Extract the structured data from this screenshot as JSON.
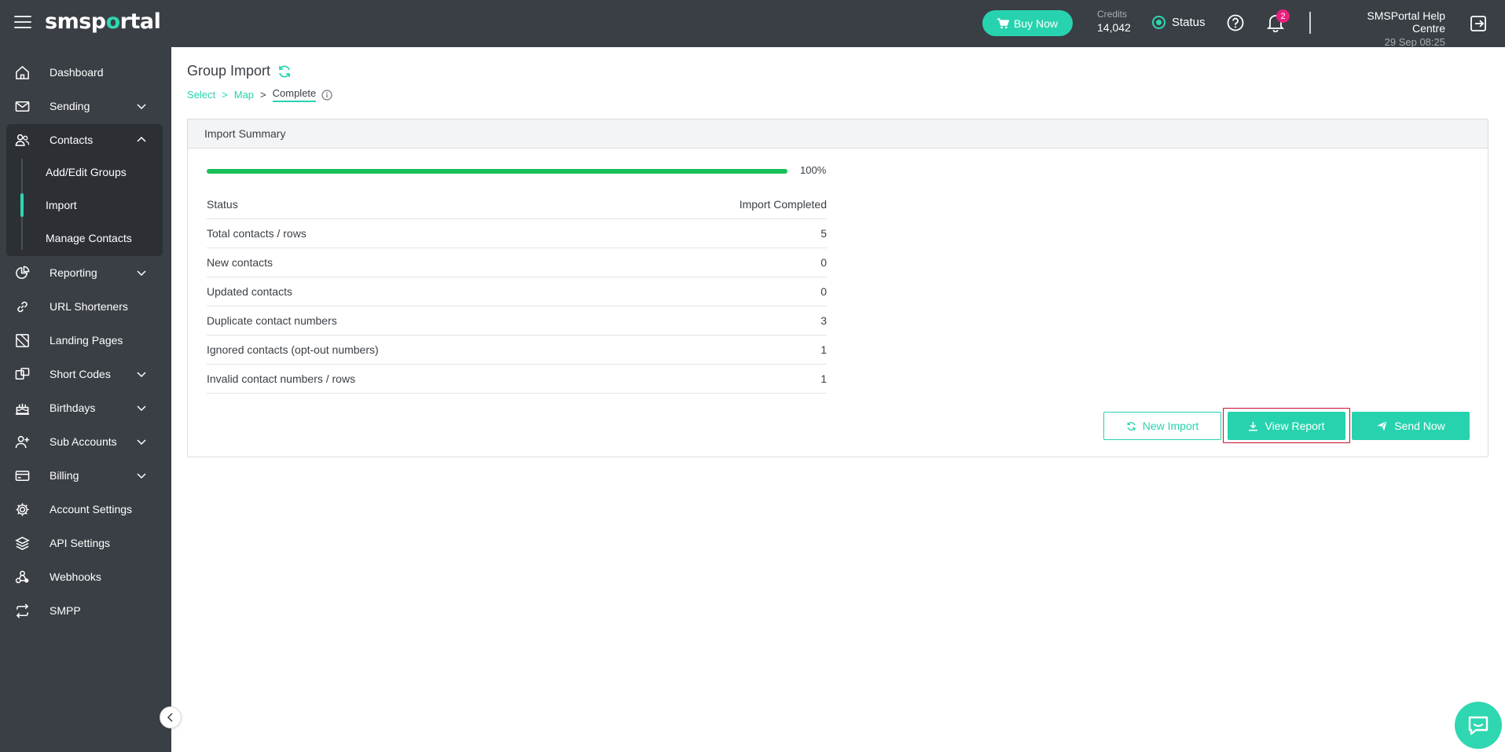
{
  "brand": {
    "logo_left": "sms",
    "logo_o": "o",
    "logo_pre": "sms",
    "logo_p": "p",
    "logo_rest": "rtal",
    "accent": "#27d3ae",
    "sidebar_bg": "#3a3f45"
  },
  "header": {
    "buy_now": "Buy Now",
    "credits_label": "Credits",
    "credits_value": "14,042",
    "status_label": "Status",
    "notifications_count": "2",
    "user_name": "SMSPortal Help Centre",
    "datetime": "29 Sep 08:25"
  },
  "sidebar": {
    "items": [
      {
        "label": "Dashboard",
        "icon": "home-icon"
      },
      {
        "label": "Sending",
        "icon": "envelope-icon"
      },
      {
        "label": "Contacts",
        "icon": "users-icon"
      },
      {
        "label": "Reporting",
        "icon": "pie-chart-icon"
      },
      {
        "label": "URL Shorteners",
        "icon": "link-icon"
      },
      {
        "label": "Landing Pages",
        "icon": "landing-page-icon"
      },
      {
        "label": "Short Codes",
        "icon": "short-codes-icon"
      },
      {
        "label": "Birthdays",
        "icon": "cake-icon"
      },
      {
        "label": "Sub Accounts",
        "icon": "user-plus-icon"
      },
      {
        "label": "Billing",
        "icon": "credit-card-icon"
      },
      {
        "label": "Account Settings",
        "icon": "gear-icon"
      },
      {
        "label": "API Settings",
        "icon": "layers-icon"
      },
      {
        "label": "Webhooks",
        "icon": "webhook-icon"
      },
      {
        "label": "SMPP",
        "icon": "repeat-icon"
      }
    ],
    "contacts_sub": [
      "Add/Edit Groups",
      "Import",
      "Manage Contacts"
    ]
  },
  "page": {
    "title": "Group Import",
    "breadcrumb": {
      "select": "Select",
      "map": "Map",
      "complete": "Complete",
      "sep": ">"
    }
  },
  "summary": {
    "heading": "Import Summary",
    "progress_percent": 100,
    "progress_label": "100%",
    "rows": [
      {
        "label": "Status",
        "value": "Import Completed"
      },
      {
        "label": "Total contacts / rows",
        "value": "5"
      },
      {
        "label": "New contacts",
        "value": "0"
      },
      {
        "label": "Updated contacts",
        "value": "0"
      },
      {
        "label": "Duplicate contact numbers",
        "value": "3"
      },
      {
        "label": "Ignored contacts (opt-out numbers)",
        "value": "1"
      },
      {
        "label": "Invalid contact numbers / rows",
        "value": "1"
      }
    ],
    "buttons": {
      "new_import": "New Import",
      "view_report": "View Report",
      "send_now": "Send Now"
    }
  }
}
